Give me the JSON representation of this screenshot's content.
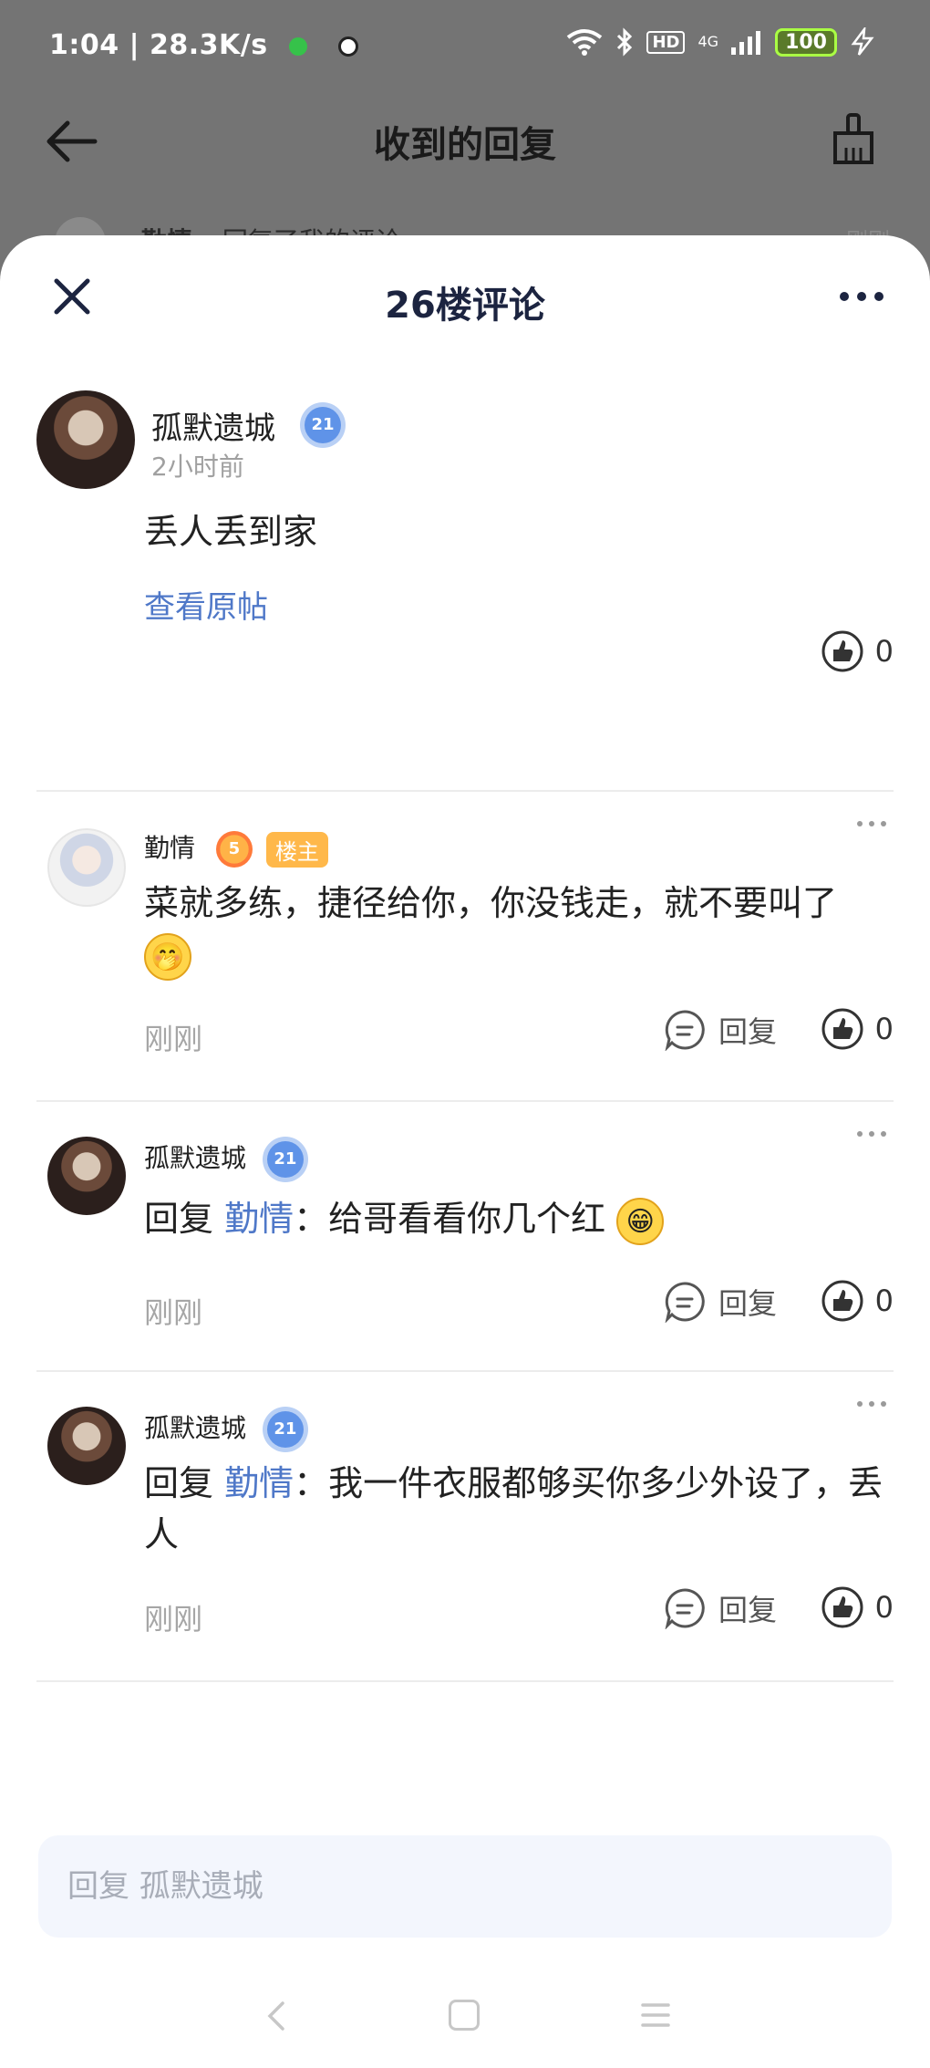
{
  "status_bar": {
    "time_speed": "1:04 | 28.3K/s",
    "hd": "HD",
    "network": "4G",
    "battery": "100"
  },
  "background_page": {
    "title": "收到的回复",
    "peek_name": "勤情",
    "peek_text": "回复了我的评论",
    "peek_time": "刚刚"
  },
  "sheet": {
    "title": "26楼评论"
  },
  "main_comment": {
    "author": "孤默遗城",
    "level": "21",
    "time": "2小时前",
    "content": "丢人丢到家",
    "view_post": "查看原帖",
    "likes": "0"
  },
  "replies": [
    {
      "author": "勤情",
      "level": "5",
      "host_badge": "楼主",
      "text": "菜就多练，捷径给你，你没钱走，就不要叫了",
      "emoji": "🤭",
      "time": "刚刚",
      "reply_label": "回复",
      "likes": "0"
    },
    {
      "author": "孤默遗城",
      "level": "21",
      "prefix": "回复",
      "mention": "勤情",
      "text": "：给哥看看你几个红",
      "emoji": "😁",
      "time": "刚刚",
      "reply_label": "回复",
      "likes": "0"
    },
    {
      "author": "孤默遗城",
      "level": "21",
      "prefix": "回复",
      "mention": "勤情",
      "text": "：我一件衣服都够买你多少外设了，丢人",
      "time": "刚刚",
      "reply_label": "回复",
      "likes": "0"
    }
  ],
  "input": {
    "placeholder": "回复 孤默遗城"
  }
}
